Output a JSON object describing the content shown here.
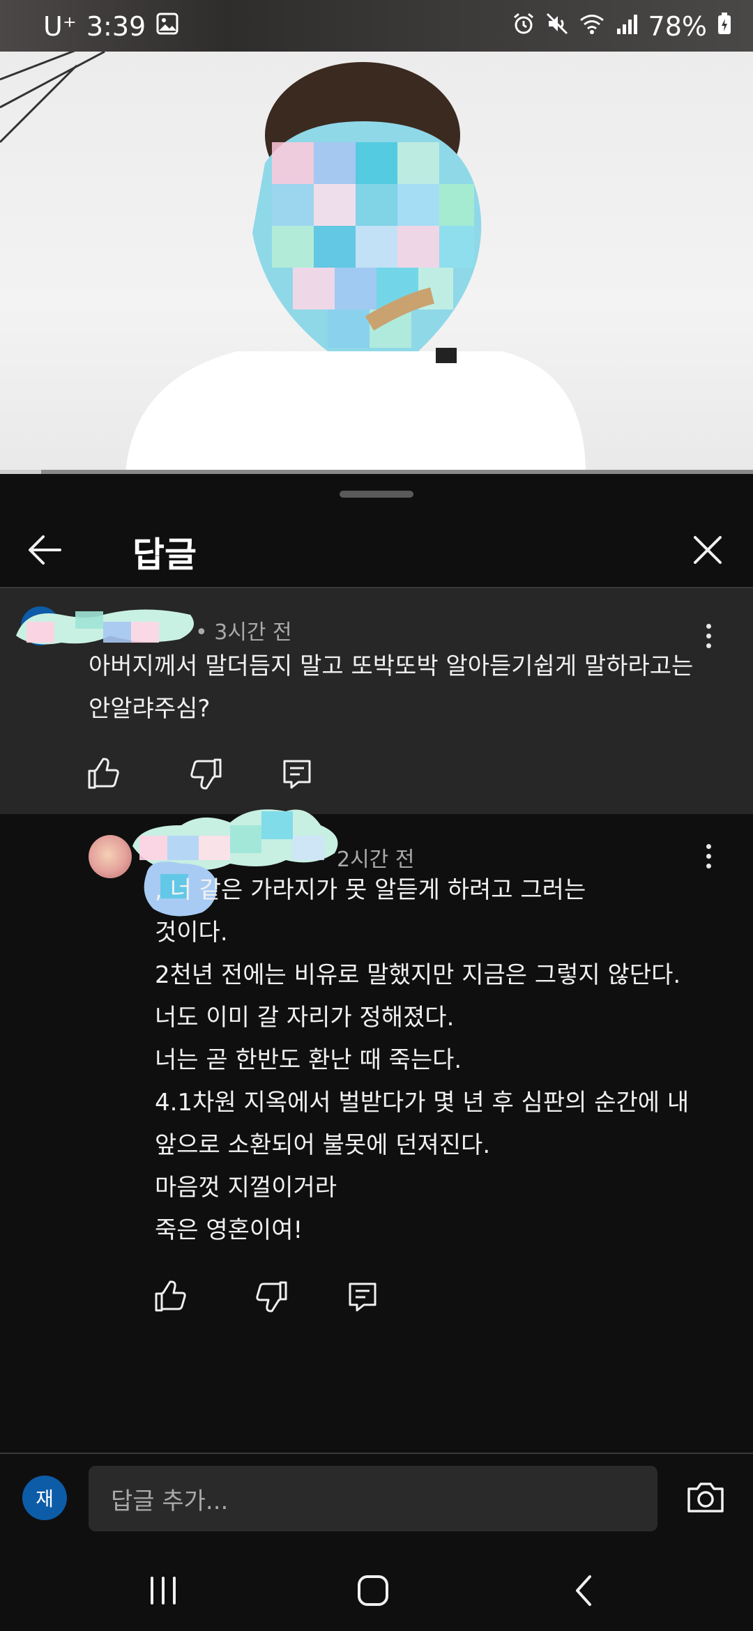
{
  "status_bar": {
    "carrier": "U⁺",
    "time": "3:39",
    "battery": "78%"
  },
  "video": {
    "progress_fraction": 0.055
  },
  "sheet": {
    "title": "답글"
  },
  "parent_comment": {
    "time": "• 3시간 전",
    "text": "아버지께서 말더듬지 말고 또박또박 알아듣기쉽게 말하라고는\n안알랴주심?"
  },
  "reply": {
    "time": "2시간 전",
    "text": ", 너 같은 가라지가 못 알듣게 하려고 그러는\n것이다.\n2천년 전에는 비유로 말했지만 지금은 그렇지 않단다.\n너도 이미 갈 자리가 정해졌다.\n너는 곧 한반도 환난 때 죽는다.\n4.1차원 지옥에서 벌받다가 몇 년 후 심판의 순간에 내\n앞으로 소환되어 불못에 던져진다.\n마음껏 지껄이거라\n죽은 영혼이여!"
  },
  "composer": {
    "avatar_letter": "재",
    "placeholder": "답글 추가..."
  },
  "colors": {
    "background": "#0f0f0f",
    "highlight": "#272727",
    "avatar_blue": "#0d5ca8"
  }
}
